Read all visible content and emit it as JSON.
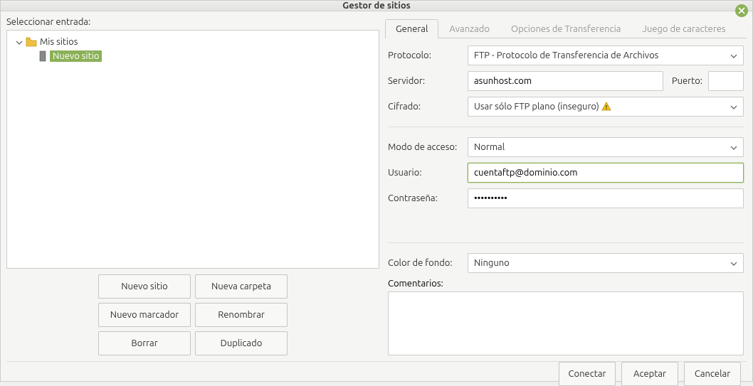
{
  "window": {
    "title": "Gestor de sitios"
  },
  "left": {
    "select_label": "Seleccionar entrada:",
    "root_label": "Mis sitios",
    "site_label": "Nuevo sitio",
    "buttons": {
      "new_site": "Nuevo sitio",
      "new_folder": "Nueva carpeta",
      "new_bookmark": "Nuevo marcador",
      "rename": "Renombrar",
      "delete": "Borrar",
      "duplicate": "Duplicado"
    }
  },
  "tabs": {
    "general": "General",
    "advanced": "Avanzado",
    "transfer": "Opciones de Transferencia",
    "charset": "Juego de caracteres"
  },
  "form": {
    "protocol_label": "Protocolo:",
    "protocol_value": "FTP - Protocolo de Transferencia de Archivos",
    "server_label": "Servidor:",
    "server_value": "asunhost.com",
    "port_label": "Puerto:",
    "port_value": "",
    "encryption_label": "Cifrado:",
    "encryption_value": "Usar sólo FTP plano (inseguro) ",
    "access_label": "Modo de acceso:",
    "access_value": "Normal",
    "user_label": "Usuario:",
    "user_value": "cuentaftp@dominio.com",
    "password_label": "Contraseña:",
    "password_value": "••••••••••",
    "bgcolor_label": "Color de fondo:",
    "bgcolor_value": "Ninguno",
    "comments_label": "Comentarios:",
    "comments_value": ""
  },
  "footer": {
    "connect": "Conectar",
    "accept": "Aceptar",
    "cancel": "Cancelar"
  }
}
